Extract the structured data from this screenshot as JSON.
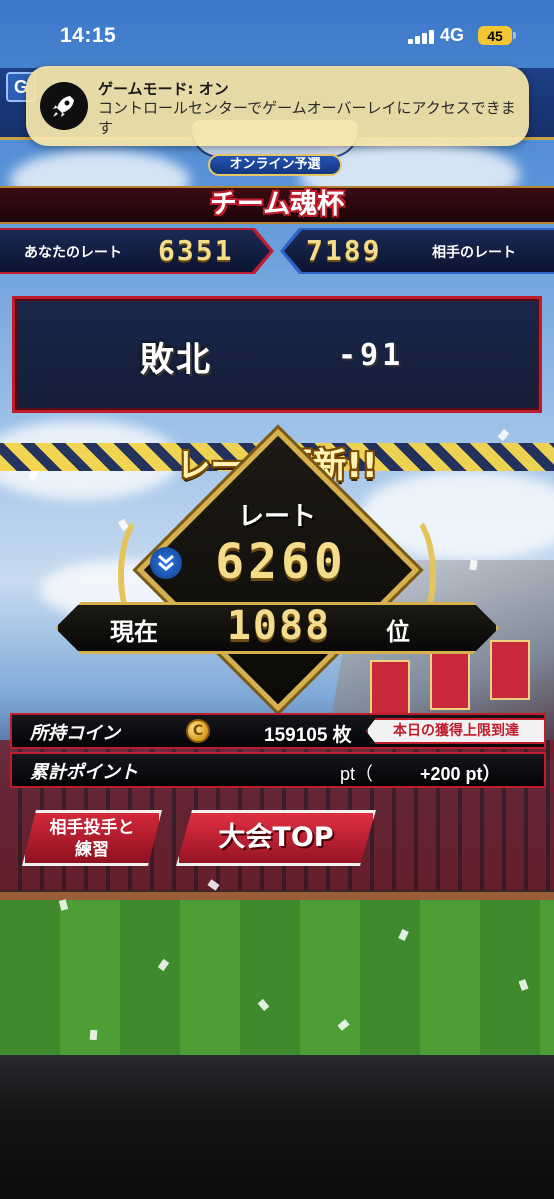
{
  "status_bar": {
    "time": "14:15",
    "network": "4G",
    "battery": "45"
  },
  "game_header": {
    "menu_label": "G",
    "subtitle": "オンライン予選"
  },
  "notification": {
    "title": "ゲームモード: オン",
    "body": "コントロールセンターでゲームオーバーレイにアクセスできます",
    "icon": "rocket-icon"
  },
  "cup": {
    "title": "チーム魂杯"
  },
  "rates": {
    "your_label": "あなたのレート",
    "your_value": "6351",
    "opponent_label": "相手のレート",
    "opponent_value": "7189"
  },
  "result": {
    "outcome": "敗北",
    "delta": "-91"
  },
  "rate_update": {
    "title": "レート更新!!",
    "caption": "レート",
    "value": "6260",
    "trend_icon": "double-chevron-down-icon",
    "rank_prefix": "現在",
    "rank_value": "1088",
    "rank_suffix": "位"
  },
  "coins": {
    "label": "所持コイン",
    "icon": "coin-icon",
    "icon_letter": "C",
    "value": "159105 枚",
    "limit_badge": "本日の獲得上限到達"
  },
  "points": {
    "label": "累計ポイント",
    "unit_open": "pt（",
    "bonus": "+200 pt）"
  },
  "buttons": {
    "practice_line1": "相手投手と",
    "practice_line2": "練習",
    "top": "大会TOP"
  },
  "colors": {
    "accent_red": "#c01d2c",
    "gold": "#d7b04e",
    "number_gold": "#f4dc8a",
    "navy": "#0c1430"
  }
}
